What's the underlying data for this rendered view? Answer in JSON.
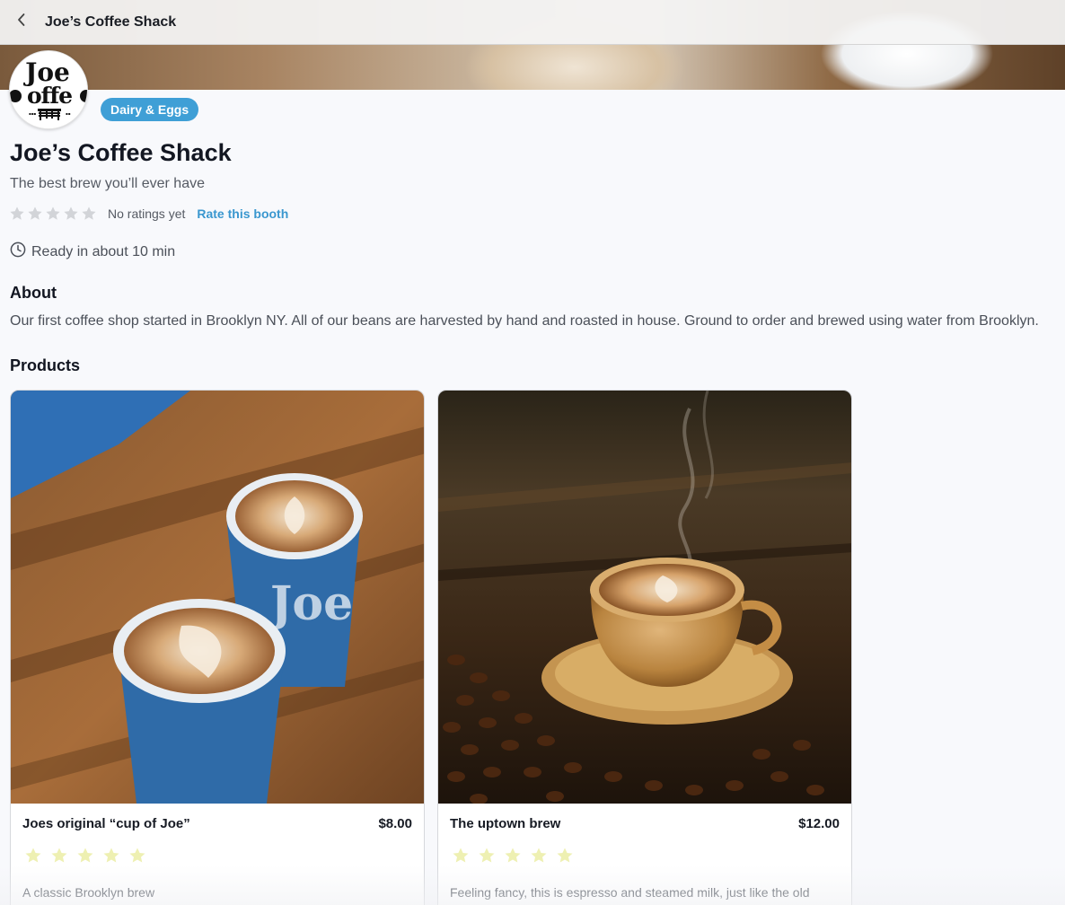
{
  "header": {
    "title": "Joe’s Coffee Shack",
    "back_icon": "chevron-left-icon"
  },
  "booth": {
    "logo_text": "Joe Coffee",
    "category": "Dairy & Eggs",
    "name": "Joe’s Coffee Shack",
    "tagline": "The best brew you’ll ever have",
    "rating_stars": 0,
    "rating_max": 5,
    "rating_text": "No ratings yet",
    "rate_link": "Rate this booth",
    "ready_text": "Ready in about 10 min"
  },
  "about": {
    "title": "About",
    "text": "Our first coffee shop started in Brooklyn NY. All of our beans are harvested by hand and roasted in house. Ground to order and brewed using water from Brooklyn."
  },
  "products": {
    "title": "Products",
    "items": [
      {
        "name": "Joes original “cup of Joe”",
        "price": "$8.00",
        "stars": 5,
        "description": "A classic Brooklyn brew",
        "cup_print": "Joe"
      },
      {
        "name": "The uptown brew",
        "price": "$12.00",
        "stars": 5,
        "description": "Feeling fancy, this is espresso and steamed milk, just like the old"
      }
    ]
  },
  "colors": {
    "accent": "#3f9fd6",
    "link": "#3a97cf",
    "star_empty": "#d2d4d8",
    "star_product": "#eef0b2"
  }
}
